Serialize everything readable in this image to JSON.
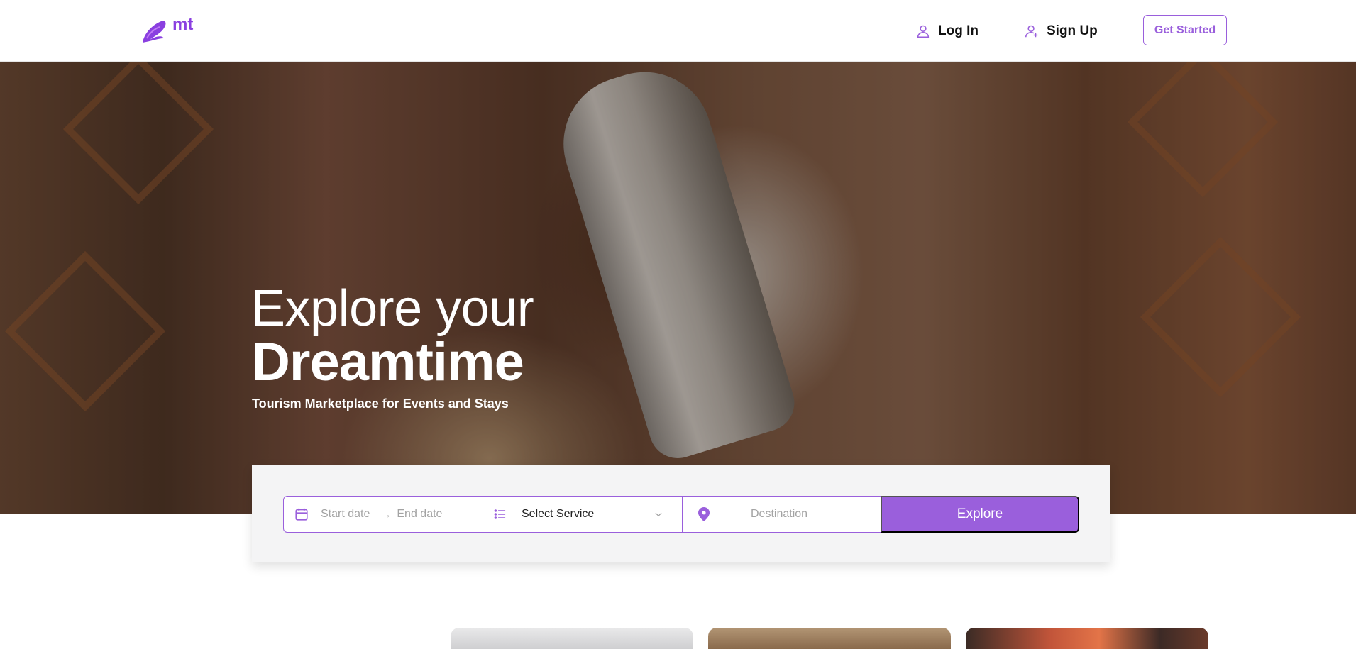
{
  "header": {
    "logo_text": "mt",
    "login_label": "Log In",
    "signup_label": "Sign Up",
    "get_started_label": "Get Started"
  },
  "hero": {
    "title_line1": "Explore your",
    "title_line2": "Dreamtime",
    "subtitle": "Tourism Marketplace for Events and Stays"
  },
  "search": {
    "start_date_placeholder": "Start date",
    "end_date_placeholder": "End date",
    "date_separator": "→",
    "service_value": "Select Service",
    "destination_placeholder": "Destination",
    "explore_label": "Explore"
  },
  "icons": {
    "login": "user-icon",
    "signup": "user-plus-icon",
    "date": "calendar-icon",
    "service": "list-icon",
    "service_dropdown": "chevron-down-icon",
    "destination": "map-pin-icon"
  },
  "colors": {
    "accent": "#9a5fdc",
    "panel_bg": "#f4f4f5",
    "text_dark": "#111111"
  }
}
